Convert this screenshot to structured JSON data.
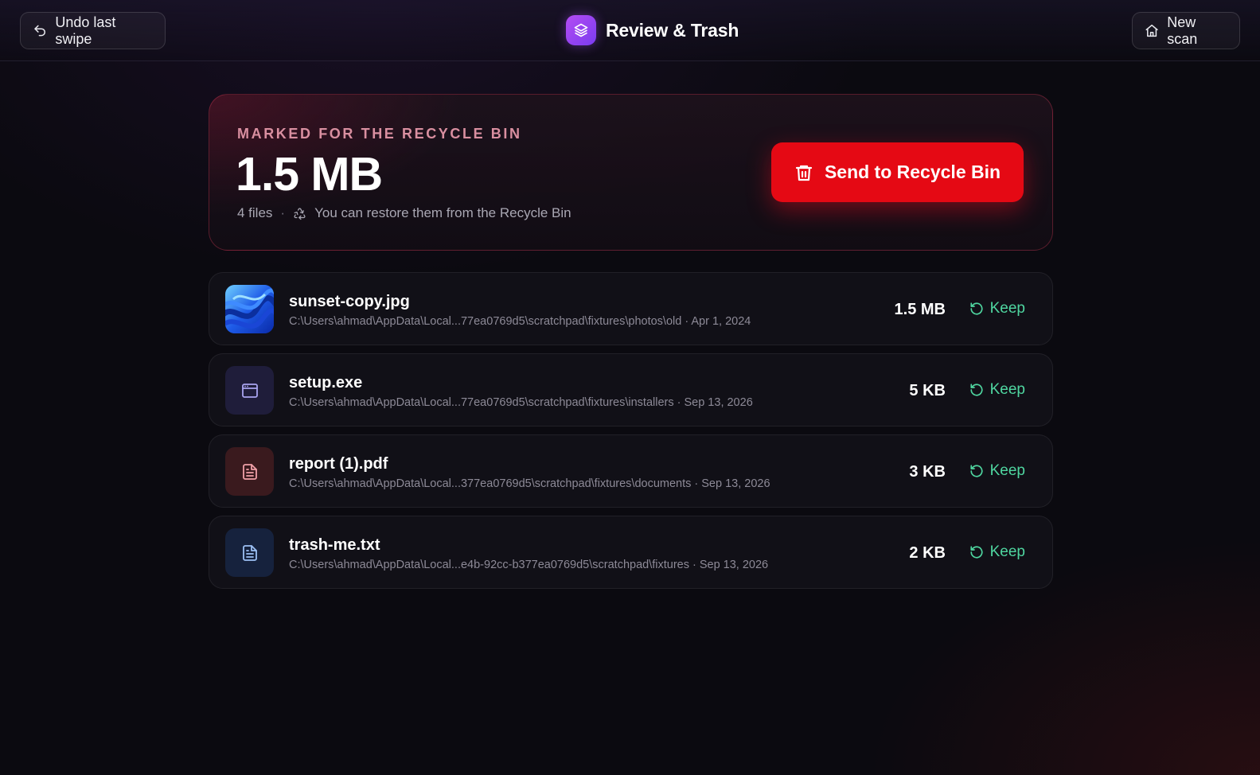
{
  "header": {
    "undo_label": "Undo last swipe",
    "title": "Review & Trash",
    "new_scan_label": "New scan"
  },
  "summary": {
    "kicker": "MARKED FOR THE RECYCLE BIN",
    "total_size": "1.5 MB",
    "file_count": "4 files",
    "separator": "·",
    "restore_note": "You can restore them from the Recycle Bin",
    "send_label": "Send to Recycle Bin"
  },
  "files": [
    {
      "name": "sunset-copy.jpg",
      "path": "C:\\Users\\ahmad\\AppData\\Local...77ea0769d5\\scratchpad\\fixtures\\photos\\old · Apr 1, 2024",
      "size": "1.5 MB",
      "keep_label": "Keep",
      "icon": "image-thumbnail"
    },
    {
      "name": "setup.exe",
      "path": "C:\\Users\\ahmad\\AppData\\Local...77ea0769d5\\scratchpad\\fixtures\\installers · Sep 13, 2026",
      "size": "5 KB",
      "keep_label": "Keep",
      "icon": "app-window-icon"
    },
    {
      "name": "report (1).pdf",
      "path": "C:\\Users\\ahmad\\AppData\\Local...377ea0769d5\\scratchpad\\fixtures\\documents · Sep 13, 2026",
      "size": "3 KB",
      "keep_label": "Keep",
      "icon": "document-icon"
    },
    {
      "name": "trash-me.txt",
      "path": "C:\\Users\\ahmad\\AppData\\Local...e4b-92cc-b377ea0769d5\\scratchpad\\fixtures · Sep 13, 2026",
      "size": "2 KB",
      "keep_label": "Keep",
      "icon": "text-file-icon"
    }
  ],
  "colors": {
    "accent_red": "#e50914",
    "keep_green": "#4fd6a0",
    "brand_purple": "#b44cf2"
  }
}
